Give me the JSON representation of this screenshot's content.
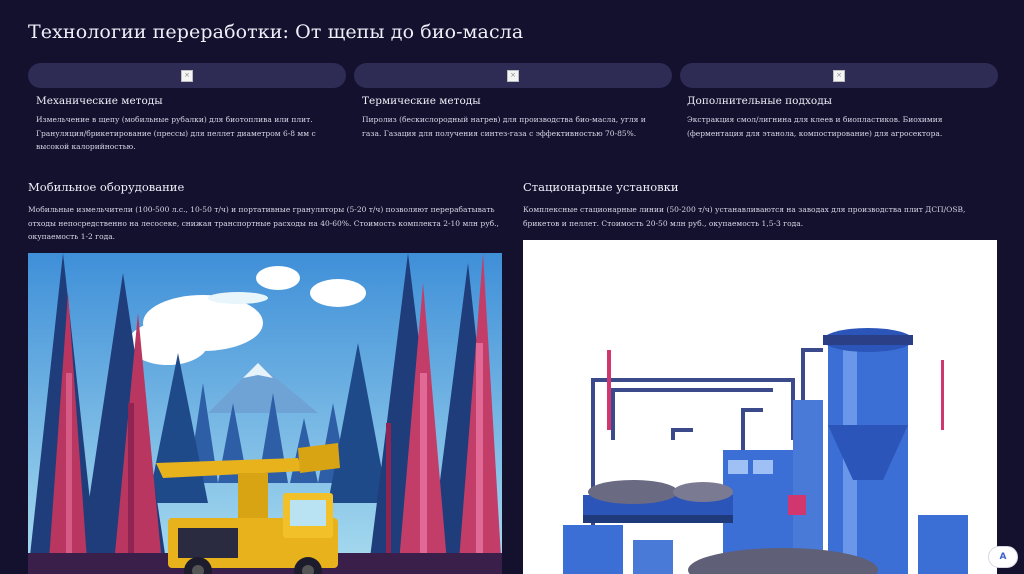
{
  "page": {
    "title": "Технологии переработки: От щепы до био-масла"
  },
  "cards": [
    {
      "image_alt": "×",
      "heading": "Механические методы",
      "text": "Измельчение в щепу (мобильные рубалки) для биотоплива или плит. Грануляция/брикетирование (прессы) для пеллет диаметром 6-8 мм с высокой калорийностью."
    },
    {
      "image_alt": "×",
      "heading": "Термические методы",
      "text": "Пиролиз (бескислородный нагрев) для производства био-масла, угля и газа. Газация для получения синтез-газа с эффективностью 70-85%."
    },
    {
      "image_alt": "×",
      "heading": "Дополнительные подходы",
      "text": "Экстракция смол/лигнина для клеев и биопластиков. Биохимия (ферментация для этанола, компостирование) для агросектора."
    }
  ],
  "sections": {
    "mobile": {
      "heading": "Мобильное оборудование",
      "text": "Мобильные измельчители (100-500 л.с., 10-50 т/ч) и портативные грануляторы (5-20 т/ч) позволяют перерабатывать отходы непосредственно на лесосеке, снижая транспортные расходы на 40-60%. Стоимость комплекта 2-10 млн руб., окупаемость 1-2 года."
    },
    "stationary": {
      "heading": "Стационарные установки",
      "text": "Комплексные стационарные линии (50-200 т/ч) устанавливаются на заводах для производства плит ДСП/OSB, брикетов и пеллет. Стоимость 20-50 млн руб., окупаемость 1,5-3 года."
    }
  },
  "corner_button": {
    "label": "A"
  },
  "colors": {
    "background": "#13112e",
    "pill": "#2e2b55",
    "accent_blue": "#3b6fd6",
    "accent_pink": "#d2366e",
    "machine_yellow": "#e8b21c"
  }
}
